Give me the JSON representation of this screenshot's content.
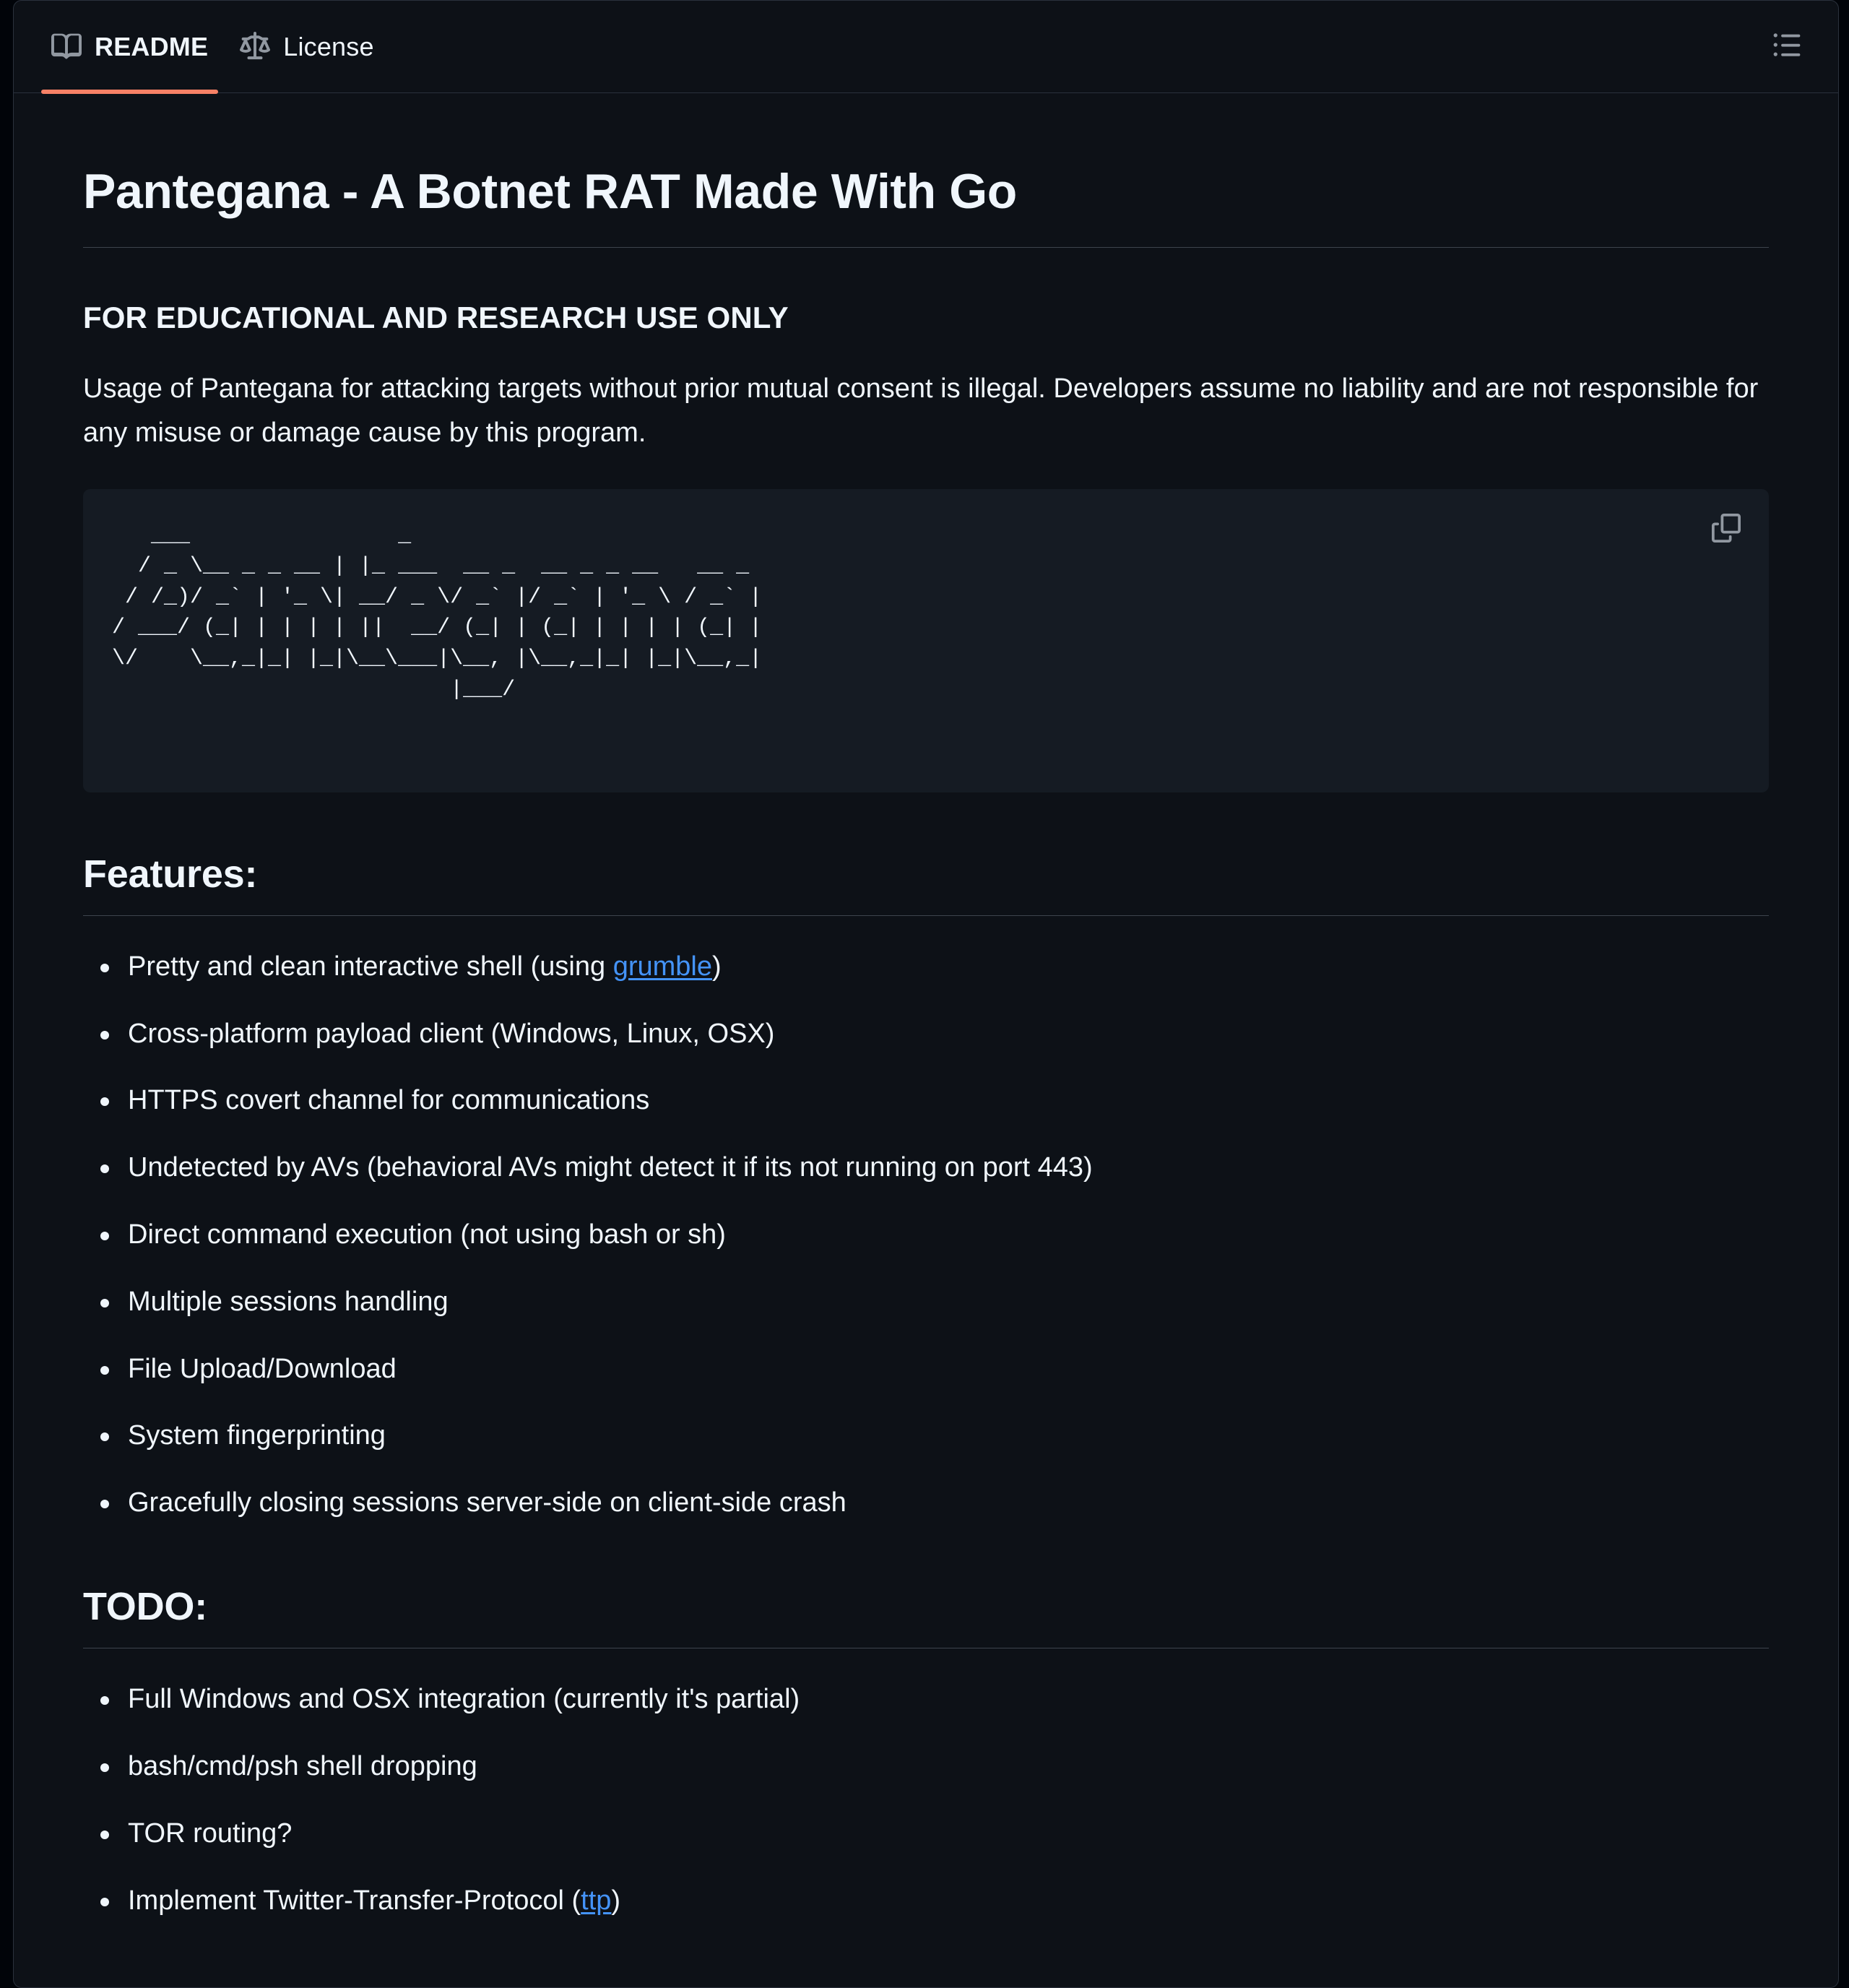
{
  "tabs": [
    {
      "id": "readme",
      "label": "README",
      "icon": "book-icon",
      "active": true
    },
    {
      "id": "license",
      "label": "License",
      "icon": "scale-icon",
      "active": false
    }
  ],
  "header": {
    "toc_icon": "list-unordered-icon",
    "toc_title": "Outline"
  },
  "document": {
    "title": "Pantegana - A Botnet RAT Made With Go",
    "notice": "FOR EDUCATIONAL AND RESEARCH USE ONLY",
    "disclaimer": "Usage of Pantegana for attacking targets without prior mutual consent is illegal. Developers assume no liability and are not responsible for any misuse or damage cause by this program.",
    "ascii_art": "   ___                _\n  / _ \\__ _ _ __ | |_ ___  __ _  __ _ _ __   __ _\n / /_)/ _` | '_ \\| __/ _ \\/ _` |/ _` | '_ \\ / _` |\n/ ___/ (_| | | | | ||  __/ (_| | (_| | | | | (_| |\n\\/    \\__,_|_| |_|\\__\\___|\\__, |\\__,_|_| |_|\\__,_|\n                          |___/",
    "copy_icon": "copy-icon",
    "copy_title": "Copy"
  },
  "features": {
    "heading": "Features:",
    "items": [
      {
        "prefix": "Pretty and clean interactive shell (using ",
        "link": "grumble",
        "suffix": ")"
      },
      {
        "prefix": "Cross-platform payload client (Windows, Linux, OSX)",
        "link": "",
        "suffix": ""
      },
      {
        "prefix": "HTTPS covert channel for communications",
        "link": "",
        "suffix": ""
      },
      {
        "prefix": "Undetected by AVs (behavioral AVs might detect it if its not running on port 443)",
        "link": "",
        "suffix": ""
      },
      {
        "prefix": "Direct command execution (not using bash or sh)",
        "link": "",
        "suffix": ""
      },
      {
        "prefix": "Multiple sessions handling",
        "link": "",
        "suffix": ""
      },
      {
        "prefix": "File Upload/Download",
        "link": "",
        "suffix": ""
      },
      {
        "prefix": "System fingerprinting",
        "link": "",
        "suffix": ""
      },
      {
        "prefix": "Gracefully closing sessions server-side on client-side crash",
        "link": "",
        "suffix": ""
      }
    ]
  },
  "todo": {
    "heading": "TODO:",
    "items": [
      {
        "prefix": "Full Windows and OSX integration (currently it's partial)",
        "link": "",
        "suffix": ""
      },
      {
        "prefix": "bash/cmd/psh shell dropping",
        "link": "",
        "suffix": ""
      },
      {
        "prefix": "TOR routing?",
        "link": "",
        "suffix": ""
      },
      {
        "prefix": "Implement Twitter-Transfer-Protocol (",
        "link": "ttp",
        "suffix": ")"
      }
    ]
  },
  "colors": {
    "page_bg": "#0d1117",
    "code_bg": "#151b23",
    "text": "#f0f6fc",
    "muted": "#9198a1",
    "border": "#3d444d",
    "link": "#4493f8",
    "active_tab_underline": "#f78166"
  }
}
